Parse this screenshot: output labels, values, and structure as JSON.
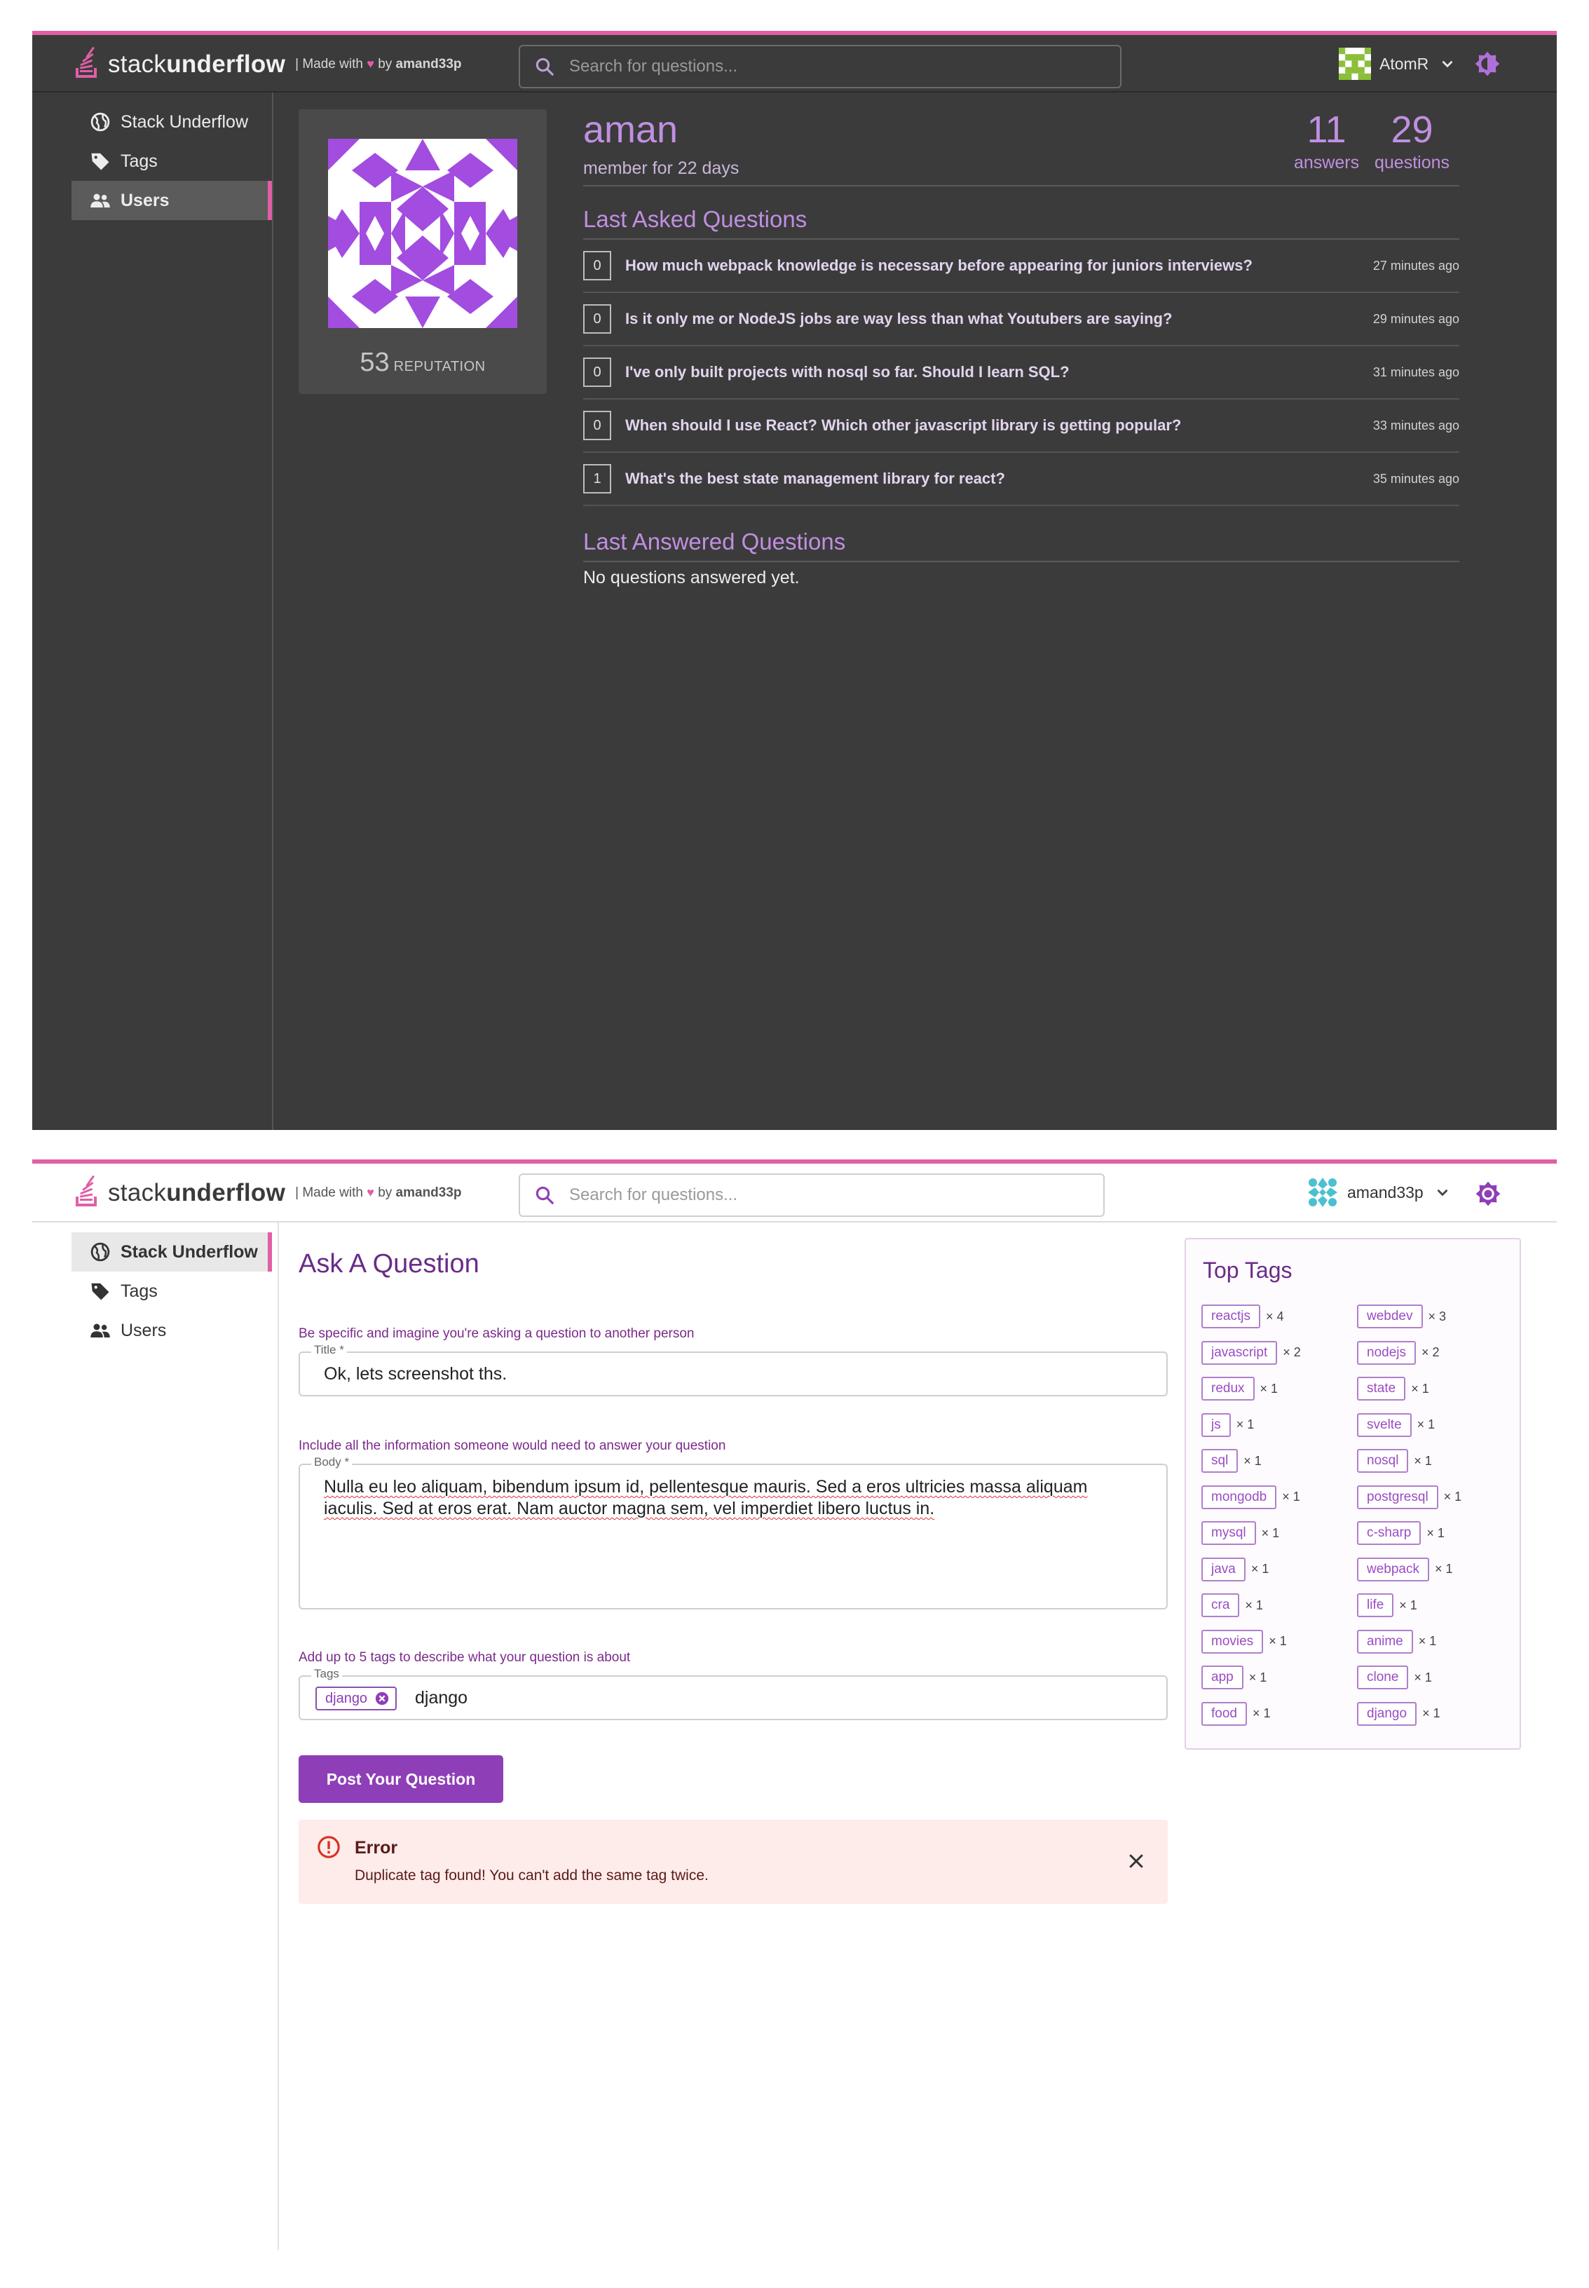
{
  "colors": {
    "accent": "#e05fa5",
    "purple": "#8e3fb8",
    "dark_bg": "#3b3b3b"
  },
  "brand": {
    "prefix": "stack",
    "suffix": "underflow",
    "made_pre": "| Made with",
    "made_by": "by",
    "made_author": "amand33p"
  },
  "search": {
    "placeholder": "Search for questions..."
  },
  "nav": {
    "home": "Stack Underflow",
    "tags": "Tags",
    "users": "Users"
  },
  "profile_view": {
    "current_user": "AtomR",
    "username": "aman",
    "member_since": "member for 22 days",
    "reputation_value": "53",
    "reputation_label": "REPUTATION",
    "answers_count": "11",
    "answers_label": "answers",
    "questions_count": "29",
    "questions_label": "questions",
    "last_asked_title": "Last Asked Questions",
    "questions": [
      {
        "score": "0",
        "title": "How much webpack knowledge is necessary before appearing for juniors interviews?",
        "time": "27 minutes ago"
      },
      {
        "score": "0",
        "title": "Is it only me or NodeJS jobs are way less than what Youtubers are saying?",
        "time": "29 minutes ago"
      },
      {
        "score": "0",
        "title": "I've only built projects with nosql so far. Should I learn SQL?",
        "time": "31 minutes ago"
      },
      {
        "score": "0",
        "title": "When should I use React? Which other javascript library is getting popular?",
        "time": "33 minutes ago"
      },
      {
        "score": "1",
        "title": "What's the best state management library for react?",
        "time": "35 minutes ago"
      }
    ],
    "last_answered_title": "Last Answered Questions",
    "no_answers": "No questions answered yet."
  },
  "ask_view": {
    "current_user": "amand33p",
    "page_title": "Ask A Question",
    "title_helper": "Be specific and imagine you're asking a question to another person",
    "title_label": "Title *",
    "title_value": "Ok, lets screenshot ths.",
    "body_helper": "Include all the information someone would need to answer your question",
    "body_label": "Body *",
    "body_value": "Nulla eu leo aliquam, bibendum ipsum id, pellentesque mauris. Sed a eros ultricies massa aliquam iaculis. Sed at eros erat. Nam auctor magna sem, vel imperdiet libero luctus in.",
    "tags_helper": "Add up to 5 tags to describe what your question is about",
    "tags_label": "Tags",
    "tag_chip": "django",
    "tags_input": "django",
    "post_button": "Post Your Question",
    "error_title": "Error",
    "error_message": "Duplicate tag found! You can't add the same tag twice.",
    "top_tags_title": "Top Tags",
    "top_tags": [
      {
        "name": "reactjs",
        "count": "× 4"
      },
      {
        "name": "webdev",
        "count": "× 3"
      },
      {
        "name": "javascript",
        "count": "× 2"
      },
      {
        "name": "nodejs",
        "count": "× 2"
      },
      {
        "name": "redux",
        "count": "× 1"
      },
      {
        "name": "state",
        "count": "× 1"
      },
      {
        "name": "js",
        "count": "× 1"
      },
      {
        "name": "svelte",
        "count": "× 1"
      },
      {
        "name": "sql",
        "count": "× 1"
      },
      {
        "name": "nosql",
        "count": "× 1"
      },
      {
        "name": "mongodb",
        "count": "× 1"
      },
      {
        "name": "postgresql",
        "count": "× 1"
      },
      {
        "name": "mysql",
        "count": "× 1"
      },
      {
        "name": "c-sharp",
        "count": "× 1"
      },
      {
        "name": "java",
        "count": "× 1"
      },
      {
        "name": "webpack",
        "count": "× 1"
      },
      {
        "name": "cra",
        "count": "× 1"
      },
      {
        "name": "life",
        "count": "× 1"
      },
      {
        "name": "movies",
        "count": "× 1"
      },
      {
        "name": "anime",
        "count": "× 1"
      },
      {
        "name": "app",
        "count": "× 1"
      },
      {
        "name": "clone",
        "count": "× 1"
      },
      {
        "name": "food",
        "count": "× 1"
      },
      {
        "name": "django",
        "count": "× 1"
      }
    ]
  }
}
